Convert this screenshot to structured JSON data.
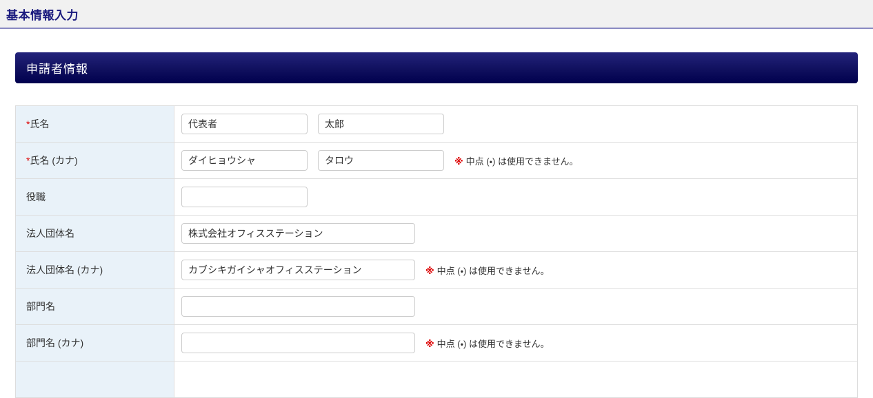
{
  "header": {
    "title": "基本情報入力"
  },
  "section": {
    "title": "申請者情報"
  },
  "required_marker": "*",
  "note": {
    "marker": "※",
    "text": "中点 (・) は使用できません。"
  },
  "colors": {
    "title_navy": "#1a1a7e",
    "banner_navy_top": "#23237b",
    "banner_navy_bottom": "#00004e",
    "required_red": "#dd0000",
    "note_red": "#dd0000",
    "label_cell_bg": "#e9f2f9",
    "topbar_bg": "#f1f1f1"
  },
  "rows": [
    {
      "id": "name",
      "label": "氏名",
      "required": true,
      "note": false,
      "inputs": [
        {
          "name": "last-name",
          "value": "代表者",
          "size": "sm"
        },
        {
          "name": "first-name",
          "value": "太郎",
          "size": "sm"
        }
      ]
    },
    {
      "id": "name-kana",
      "label": "氏名 (カナ)",
      "required": true,
      "note": true,
      "inputs": [
        {
          "name": "last-name-kana",
          "value": "ダイヒョウシャ",
          "size": "sm"
        },
        {
          "name": "first-name-kana",
          "value": "タロウ",
          "size": "sm"
        }
      ]
    },
    {
      "id": "position",
      "label": "役職",
      "required": false,
      "note": false,
      "inputs": [
        {
          "name": "position",
          "value": "",
          "size": "sm"
        }
      ]
    },
    {
      "id": "company-name",
      "label": "法人団体名",
      "required": false,
      "note": false,
      "inputs": [
        {
          "name": "company-name",
          "value": "株式会社オフィスステーション",
          "size": "lg"
        }
      ]
    },
    {
      "id": "company-name-kana",
      "label": "法人団体名 (カナ)",
      "required": false,
      "note": true,
      "inputs": [
        {
          "name": "company-name-kana",
          "value": "カブシキガイシャオフィスステーション",
          "size": "lg"
        }
      ]
    },
    {
      "id": "department-name",
      "label": "部門名",
      "required": false,
      "note": false,
      "inputs": [
        {
          "name": "department-name",
          "value": "",
          "size": "lg"
        }
      ]
    },
    {
      "id": "department-name-kana",
      "label": "部門名 (カナ)",
      "required": false,
      "note": true,
      "inputs": [
        {
          "name": "department-name-kana",
          "value": "",
          "size": "lg"
        }
      ]
    },
    {
      "id": "next-cutoff",
      "label": "",
      "required": false,
      "note": false,
      "inputs": []
    }
  ]
}
